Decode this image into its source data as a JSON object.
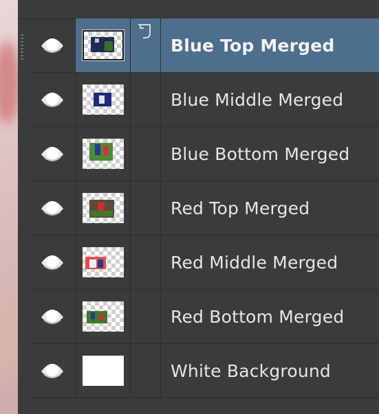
{
  "layers": [
    {
      "name": "Blue Top Merged",
      "selected": true,
      "thumb": "blue-top",
      "eye_icon": "eye-icon"
    },
    {
      "name": "Blue Middle Merged",
      "selected": false,
      "thumb": "blue-middle",
      "eye_icon": "eye-icon"
    },
    {
      "name": "Blue Bottom Merged",
      "selected": false,
      "thumb": "blue-bottom",
      "eye_icon": "eye-icon"
    },
    {
      "name": "Red Top Merged",
      "selected": false,
      "thumb": "red-top",
      "eye_icon": "eye-icon"
    },
    {
      "name": "Red Middle Merged",
      "selected": false,
      "thumb": "red-middle",
      "eye_icon": "eye-icon"
    },
    {
      "name": "Red Bottom Merged",
      "selected": false,
      "thumb": "red-bottom",
      "eye_icon": "eye-icon"
    },
    {
      "name": "White Background",
      "selected": false,
      "thumb": "white",
      "eye_icon": "eye-icon"
    }
  ],
  "colors": {
    "panel": "#3b3b3b",
    "selected": "#4e6e8e",
    "text": "#e6e6e6"
  }
}
